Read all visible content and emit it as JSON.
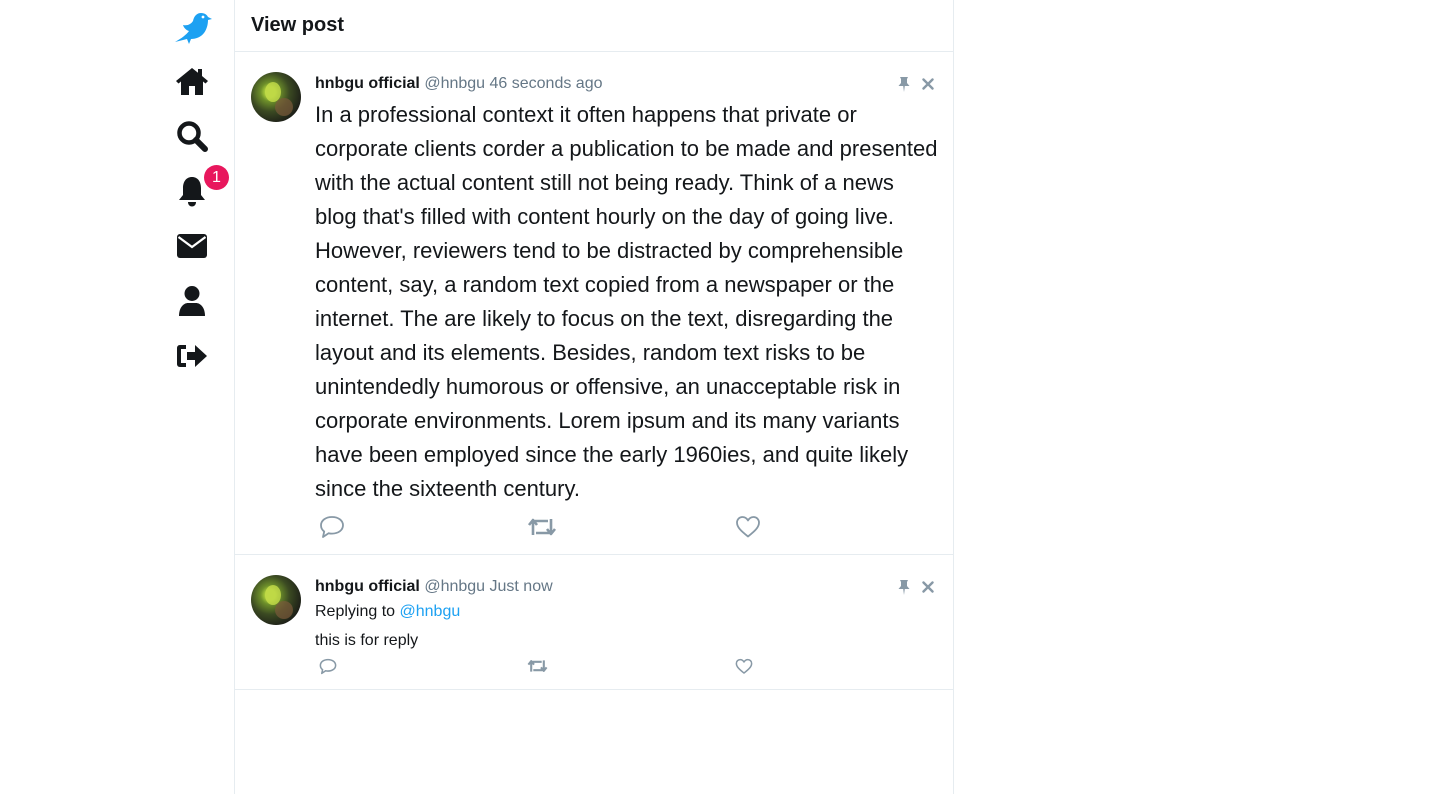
{
  "header": {
    "title": "View post"
  },
  "sidebar": {
    "items": [
      {
        "name": "logo",
        "icon": "bird-logo-icon"
      },
      {
        "name": "home",
        "icon": "home-icon"
      },
      {
        "name": "search",
        "icon": "search-icon"
      },
      {
        "name": "notifications",
        "icon": "bell-icon",
        "badge": "1"
      },
      {
        "name": "messages",
        "icon": "envelope-icon"
      },
      {
        "name": "profile",
        "icon": "user-icon"
      },
      {
        "name": "logout",
        "icon": "sign-out-icon"
      }
    ],
    "accent": "#1da1f2",
    "badge_color": "#e8175d"
  },
  "post": {
    "name": "hnbgu official",
    "handle": "@hnbgu",
    "time": "46 seconds ago",
    "text": "In a professional context it often happens that private or corporate clients corder a publication to be made and presented with the actual content still not being ready. Think of a news blog that's filled with content hourly on the day of going live. However, reviewers tend to be distracted by comprehensible content, say, a random text copied from a newspaper or the internet. The are likely to focus on the text, disregarding the layout and its elements. Besides, random text risks to be unintendedly humorous or offensive, an unacceptable risk in corporate environments. Lorem ipsum and its many variants have been employed since the early 1960ies, and quite likely since the sixteenth century."
  },
  "reply": {
    "name": "hnbgu official",
    "handle": "@hnbgu",
    "time": "Just now",
    "replying_label": "Replying to",
    "replying_to": "@hnbgu",
    "text": "this is for reply"
  }
}
